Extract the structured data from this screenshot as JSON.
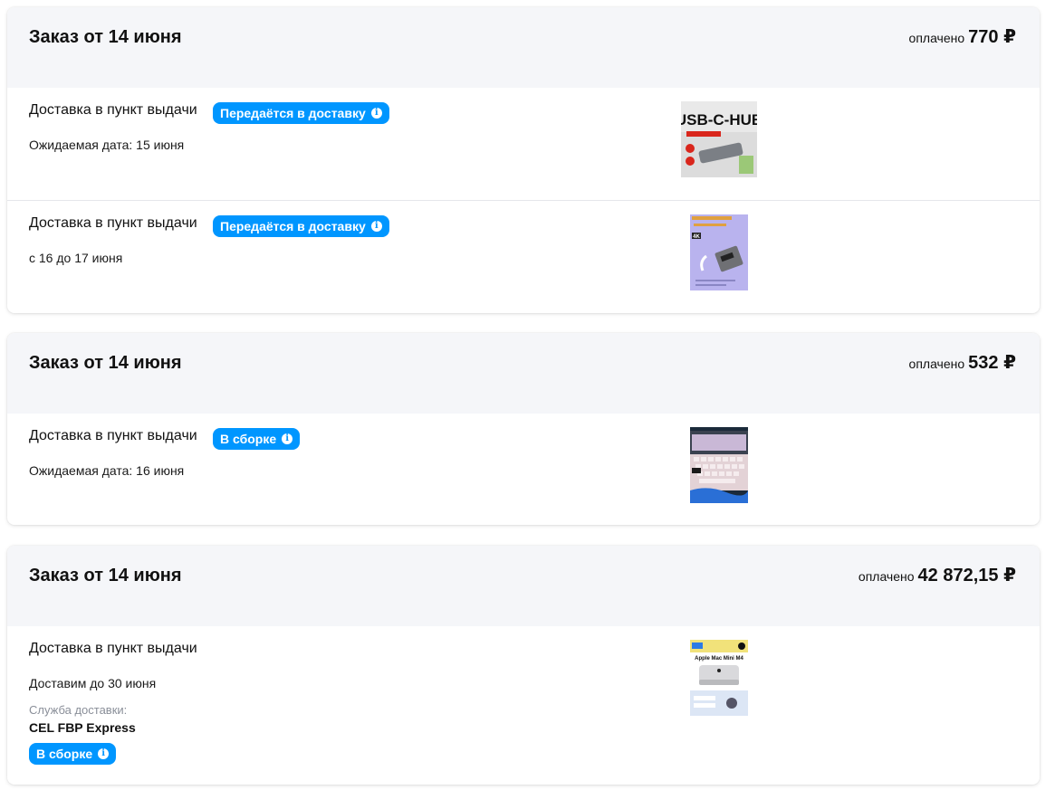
{
  "orders": [
    {
      "title": "Заказ от 14 июня",
      "paid_label": "оплачено",
      "paid_amount": "770 ₽",
      "shipments": [
        {
          "method": "Доставка в пункт выдачи",
          "status": "Передаётся в доставку",
          "date": "Ожидаемая дата: 15 июня",
          "product_image": "usb-c-hub",
          "product_text": "USB-C-HUB"
        },
        {
          "method": "Доставка в пункт выдачи",
          "status": "Передаётся в доставку",
          "date": "с 16 до 17 июня",
          "product_image": "usb-c-to-displayport-adapter",
          "product_badge": "4K"
        }
      ]
    },
    {
      "title": "Заказ от 14 июня",
      "paid_label": "оплачено",
      "paid_amount": "532 ₽",
      "shipments": [
        {
          "method": "Доставка в пункт выдачи",
          "status": "В сборке",
          "date": "Ожидаемая дата: 16 июня",
          "product_image": "backlit-keyboard"
        }
      ]
    },
    {
      "title": "Заказ от 14 июня",
      "paid_label": "оплачено",
      "paid_amount": "42 872,15 ₽",
      "shipments": [
        {
          "method": "Доставка в пункт выдачи",
          "date": "Доставим до 30 июня",
          "carrier_label": "Служба доставки:",
          "carrier_name": "CEL FBP Express",
          "status": "В сборке",
          "product_image": "apple-mac-mini-m4",
          "product_text": "Apple Mac Mini M4"
        }
      ]
    }
  ],
  "colors": {
    "badge_blue": "#0096ff",
    "header_bg": "#f5f6f9",
    "divider": "#e6e7eb"
  }
}
